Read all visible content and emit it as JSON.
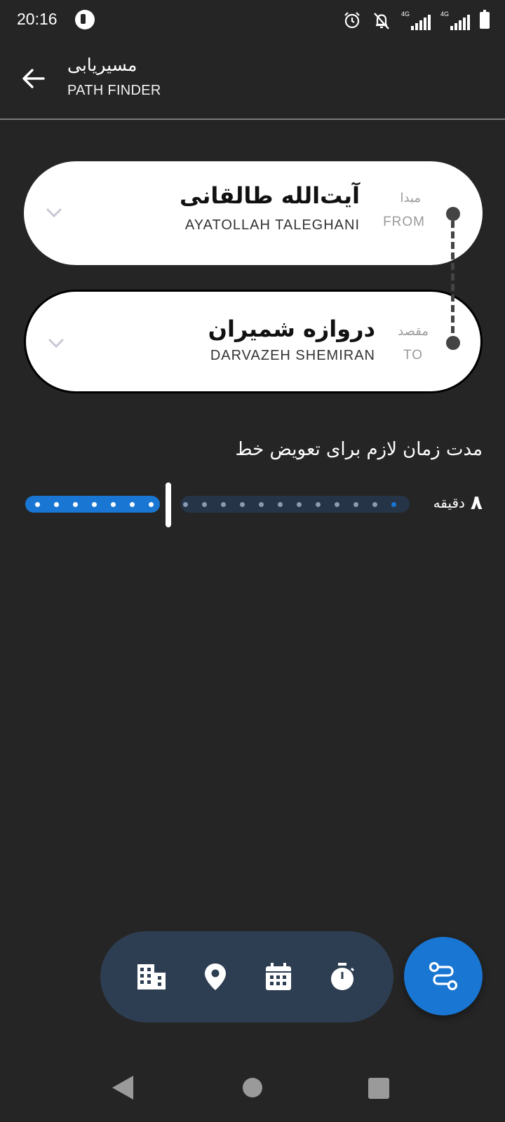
{
  "status_bar": {
    "time": "20:16",
    "network_1": "4G",
    "network_2": "4G",
    "icons": [
      "app-notification-icon",
      "alarm-icon",
      "notifications-off-icon",
      "signal-icon",
      "signal-icon",
      "battery-icon"
    ]
  },
  "app_bar": {
    "title_fa": "مسیریابی",
    "title_en": "PATH FINDER",
    "back_icon": "arrow-back-icon"
  },
  "from": {
    "role_fa": "مبدا",
    "role_en": "FROM",
    "station_fa": "آیت‌الله طالقانی",
    "station_en": "AYATOLLAH TALEGHANI"
  },
  "to": {
    "role_fa": "مقصد",
    "role_en": "TO",
    "station_fa": "دروازه شمیران",
    "station_en": "DARVAZEH SHEMIRAN"
  },
  "transfer": {
    "label": "مدت زمان لازم برای تعویض خط",
    "minutes_value": "۸",
    "minutes_unit": "دقیقه",
    "slider_value": 8,
    "slider_max": 20
  },
  "toolbar": {
    "items": [
      "building-icon",
      "location-pin-icon",
      "calendar-icon",
      "stopwatch-icon"
    ],
    "fab_icon": "route-icon"
  },
  "colors": {
    "background": "#252525",
    "accent": "#1976d2",
    "toolbar": "#2e3e52",
    "card": "#ffffff"
  }
}
